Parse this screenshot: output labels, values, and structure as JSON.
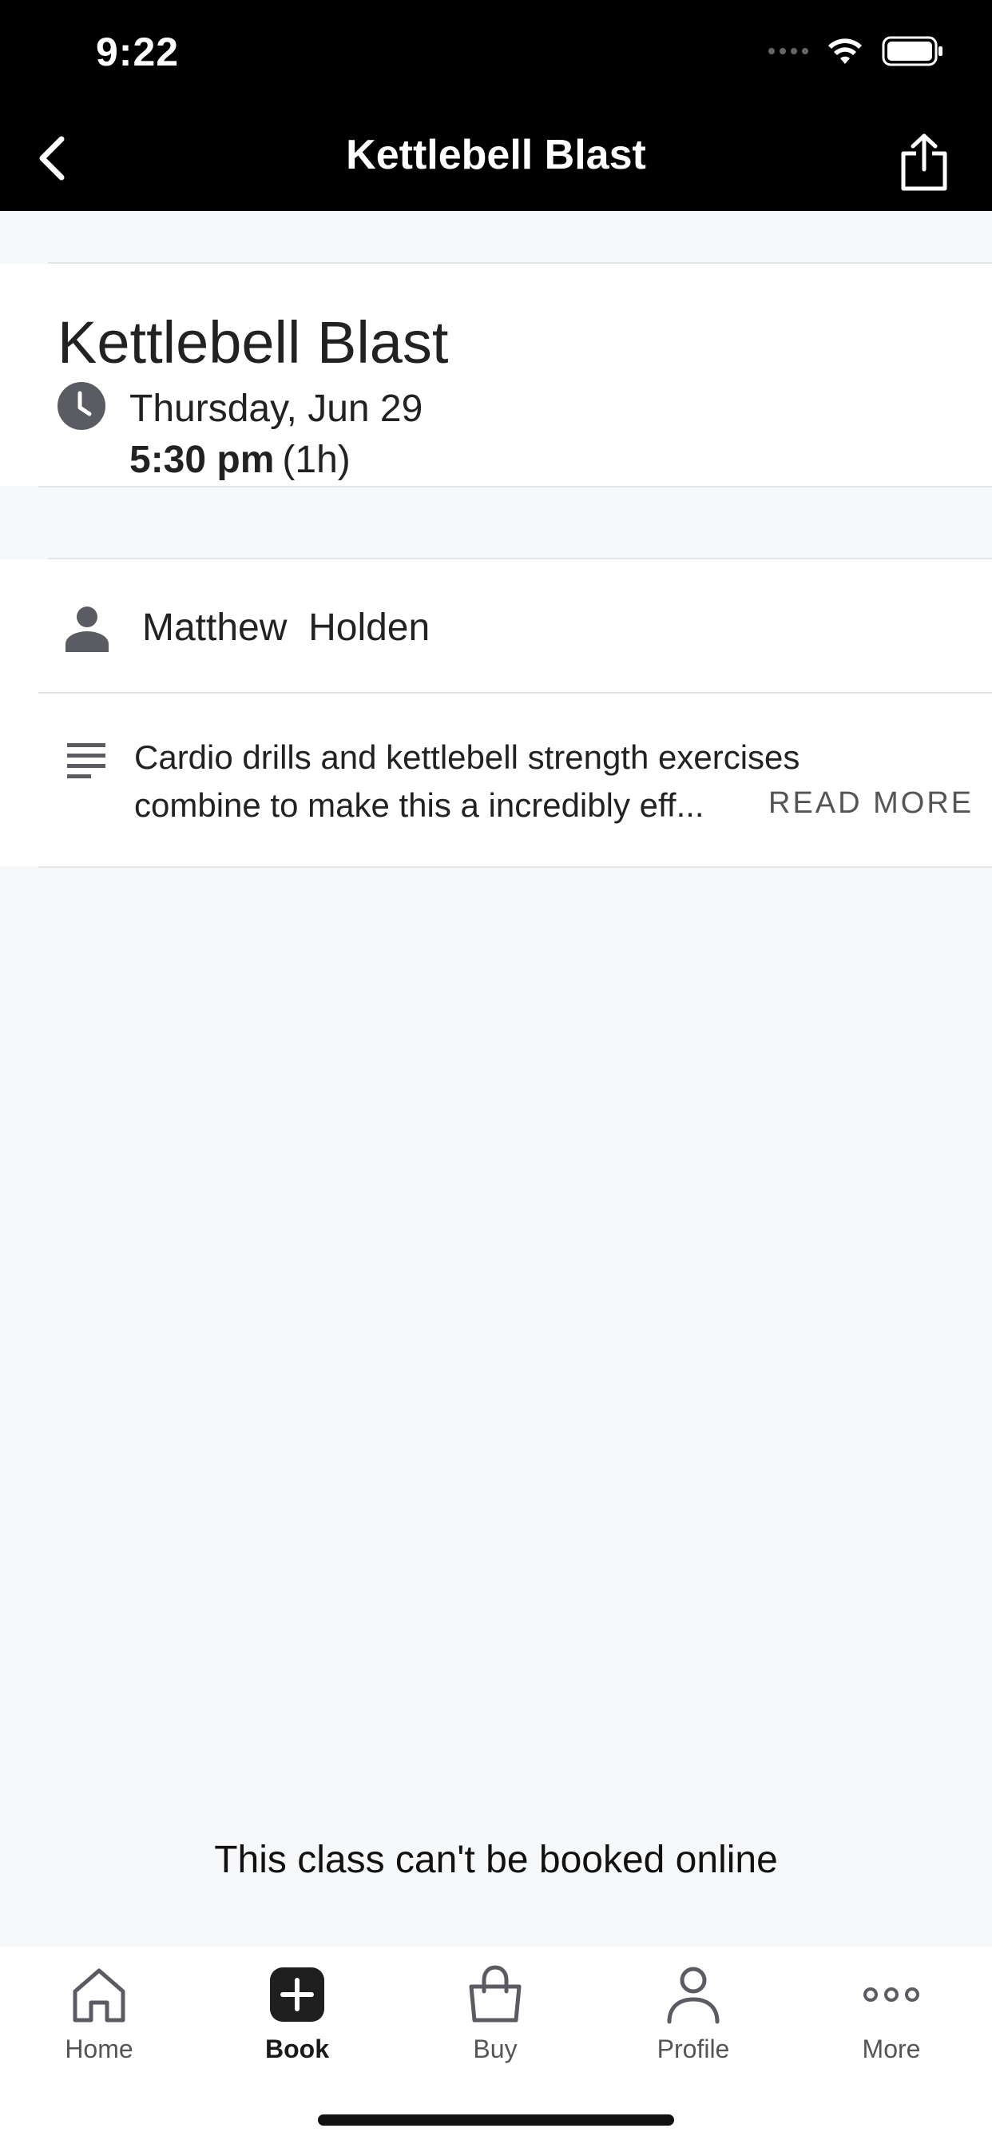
{
  "status_bar": {
    "time": "9:22"
  },
  "nav": {
    "title": "Kettlebell Blast",
    "back_icon": "chevron-left-icon",
    "share_icon": "share-icon"
  },
  "class_info": {
    "title": "Kettlebell Blast",
    "date": "Thursday, Jun 29",
    "time": "5:30 pm",
    "duration": "(1h)"
  },
  "instructor": {
    "name": "Matthew  Holden"
  },
  "description": {
    "text": "Cardio drills and kettlebell strength exercises combine to make this a incredibly eff...",
    "read_more_label": "READ MORE"
  },
  "booking_note": "This class can't be booked online",
  "tabbar": {
    "items": [
      {
        "label": "Home",
        "icon": "home-icon",
        "active": false
      },
      {
        "label": "Book",
        "icon": "plus-square-icon",
        "active": true
      },
      {
        "label": "Buy",
        "icon": "shopping-bag-icon",
        "active": false
      },
      {
        "label": "Profile",
        "icon": "person-icon",
        "active": false
      },
      {
        "label": "More",
        "icon": "more-dots-icon",
        "active": false
      }
    ]
  },
  "colors": {
    "top_bar": "#000000",
    "page_background": "#f7f8fa",
    "card_background": "#ffffff",
    "icon_gray": "#5a5b63",
    "text_dark": "#1f1f1f"
  }
}
